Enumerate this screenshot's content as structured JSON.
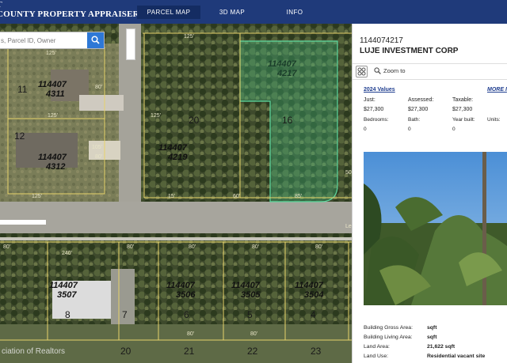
{
  "header": {
    "brand_line1": "T",
    "brand_line2": "COUNTY PROPERTY APPRAISER",
    "tabs": [
      {
        "label": "PARCEL MAP",
        "active": true
      },
      {
        "label": "3D MAP",
        "active": false
      },
      {
        "label": "INFO",
        "active": false
      }
    ]
  },
  "search": {
    "placeholder": "s, Parcel ID, Owner",
    "icon": "search-icon"
  },
  "map": {
    "attribution": "ciation of Realtors",
    "lot_numbers": [
      "11",
      "12",
      "20",
      "16",
      "8",
      "7",
      "6",
      "5",
      "4",
      "20",
      "21",
      "22",
      "23"
    ],
    "parcel_labels": [
      {
        "top": "114407",
        "bottom": "4311"
      },
      {
        "top": "114407",
        "bottom": "4312"
      },
      {
        "top": "114407",
        "bottom": "4219"
      },
      {
        "top": "114407",
        "bottom": "4217"
      },
      {
        "top": "114407",
        "bottom": "3507"
      },
      {
        "top": "114407",
        "bottom": "3506"
      },
      {
        "top": "114407",
        "bottom": "3505"
      },
      {
        "top": "114407",
        "bottom": "3504"
      }
    ],
    "dimensions": [
      "125'",
      "125'",
      "80'",
      "80'",
      "105'",
      "125'",
      "60'",
      "85'",
      "50'",
      "15'",
      "80'",
      "240'",
      "80'",
      "80'",
      "80'",
      "80'",
      "125'",
      "125'",
      "80'",
      "80'"
    ],
    "street_label": "Le",
    "highlight_color": "#2fa36b"
  },
  "panel": {
    "parcel_id": "1144074217",
    "owner": "LUJE INVESTMENT CORP",
    "zoom_label": "Zoom to",
    "values_title": "2024 Values",
    "more_link": "MORE I",
    "values": {
      "just_label": "Just:",
      "just_value": "$27,300",
      "assessed_label": "Assessed:",
      "assessed_value": "$27,300",
      "taxable_label": "Taxable:",
      "taxable_value": "$27,300",
      "bedrooms_label": "Bedrooms:",
      "bedrooms_value": "0",
      "bath_label": "Bath:",
      "bath_value": "0",
      "year_built_label": "Year built:",
      "year_built_value": "0",
      "units_label": "Units:"
    },
    "details": [
      {
        "label": "Building Gross Area:",
        "value": "sqft"
      },
      {
        "label": "Building Living Area:",
        "value": "sqft"
      },
      {
        "label": "Land Area:",
        "value": "21,622 sqft"
      },
      {
        "label": "Land Use:",
        "value": "Residential vacant site"
      }
    ]
  },
  "colors": {
    "header_bg": "#1f3a7a",
    "active_tab": "#142c62",
    "search_button": "#2e78d6",
    "link": "#1e3d8f",
    "parcel_line": "#e7d36a"
  }
}
